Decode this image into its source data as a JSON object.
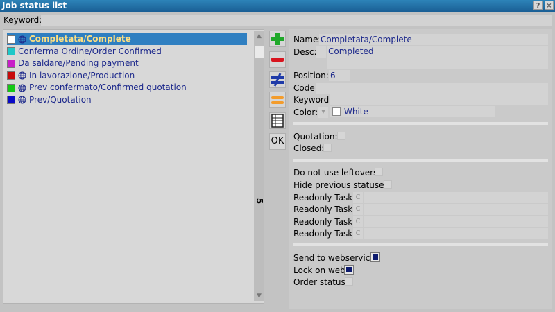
{
  "window": {
    "title": "Job status list",
    "help_btn": "?",
    "close_btn": "×"
  },
  "keyword": {
    "label": "Keyword:",
    "value": ""
  },
  "list": {
    "count": "5",
    "items": [
      {
        "label": "Completata/Complete",
        "color": "#ffffff",
        "globe": true,
        "selected": true
      },
      {
        "label": "Conferma Ordine/Order Confirmed",
        "color": "#1ec8c8",
        "globe": false
      },
      {
        "label": "Da saldare/Pending payment",
        "color": "#c81ec8",
        "globe": false
      },
      {
        "label": "In lavorazione/Production",
        "color": "#c80a0a",
        "globe": true
      },
      {
        "label": "Prev confermato/Confirmed quotation",
        "color": "#14c814",
        "globe": true
      },
      {
        "label": "Prev/Quotation",
        "color": "#0a0ac8",
        "globe": true
      }
    ]
  },
  "toolbar": {
    "ok_label": "OK"
  },
  "detail": {
    "name_label": "Name:",
    "name_value": "Completata/Complete",
    "desc_label": "Desc:",
    "desc_value": "Completed",
    "position_label": "Position:",
    "position_value": "6",
    "code_label": "Code:",
    "code_value": "",
    "keyword_label": "Keyword:",
    "keyword_value": "",
    "color_label": "Color:",
    "color_value": "White",
    "quotation_label": "Quotation:",
    "closed_label": "Closed:",
    "leftovers_label": "Do not use leftovers:",
    "hide_prev_label": "Hide previous statuses:",
    "readonly_label": "Readonly Task:",
    "readonly_btn": "C",
    "send_web_label": "Send to webservice:",
    "lock_web_label": "Lock on web:",
    "order_status_label": "Order status:"
  }
}
